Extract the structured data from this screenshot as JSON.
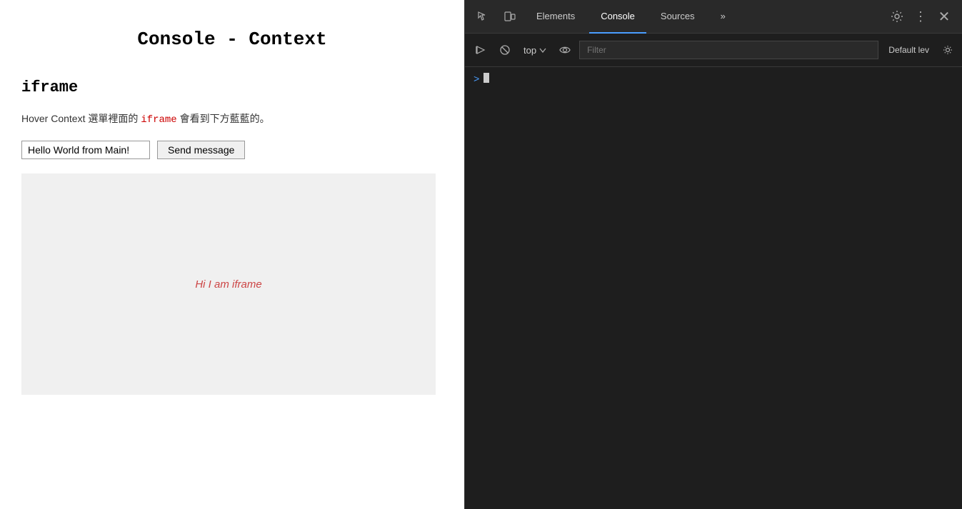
{
  "mainPage": {
    "title": "Console - Context",
    "iframeHeading": "iframe",
    "instructionLine1": "Hover Context 選單裡面的 ",
    "instructionCode": "iframe",
    "instructionLine2": " 會看到下方藍藍的。",
    "inputValue": "Hello World from Main!",
    "sendButtonLabel": "Send message",
    "iframeText": "Hi I am iframe"
  },
  "devtools": {
    "tabs": [
      {
        "label": "Elements",
        "active": false
      },
      {
        "label": "Console",
        "active": true
      },
      {
        "label": "Sources",
        "active": false
      }
    ],
    "moreTabsLabel": "»",
    "contextSelector": "top",
    "filterPlaceholder": "Filter",
    "defaultLevelLabel": "Default lev",
    "icons": {
      "inspect": "⬜",
      "responsive": "⧉",
      "cursor": "⊘",
      "eye": "👁",
      "settings": "⚙",
      "more": "⋮",
      "close": "✕",
      "play": "▷",
      "ban": "🚫"
    }
  }
}
